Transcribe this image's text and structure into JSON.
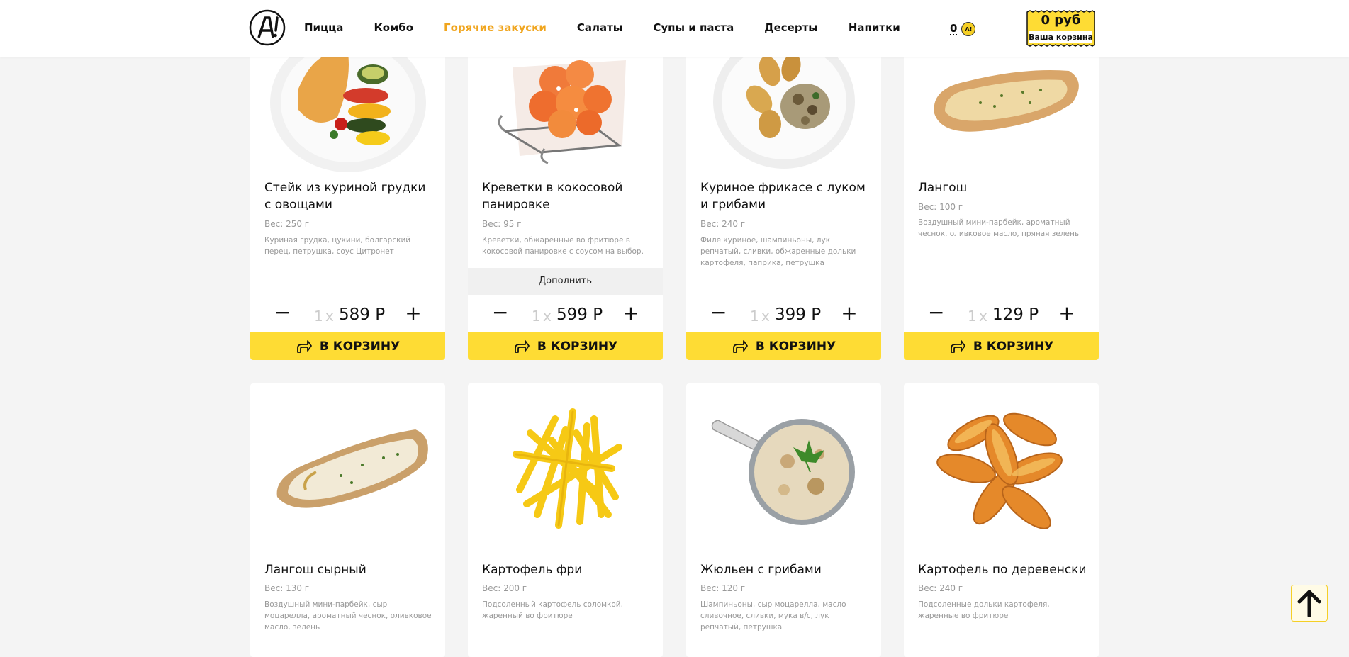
{
  "header": {
    "nav": [
      "Пицца",
      "Комбо",
      "Горячие закуски",
      "Салаты",
      "Супы и паста",
      "Десерты",
      "Напитки"
    ],
    "active_nav": "Горячие закуски",
    "coins": "0",
    "cart_sum": "0 руб",
    "cart_label": "Ваша корзина"
  },
  "products": [
    {
      "title": "Стейк из куриной грудки с овощами",
      "weight": "Вес: 250 г",
      "desc": "Куриная грудка, цукини, болгарский перец, петрушка, соус Цитронет",
      "count": "1",
      "price": "589 Р",
      "button": "В КОРЗИНУ"
    },
    {
      "title": "Креветки в кокосовой панировке",
      "weight": "Вес: 95 г",
      "desc": "Креветки, обжаренные во фритюре в кокосовой панировке с соусом на выбор.",
      "addon": "Дополнить",
      "count": "1",
      "price": "599 Р",
      "button": "В КОРЗИНУ"
    },
    {
      "title": "Куриное фрикасе с луком и грибами",
      "weight": "Вес: 240 г",
      "desc": "Филе куриное, шампиньоны, лук репчатый, сливки, обжаренные дольки картофеля, паприка, петрушка",
      "count": "1",
      "price": "399 Р",
      "button": "В КОРЗИНУ"
    },
    {
      "title": "Лангош",
      "weight": "Вес: 100 г",
      "desc": "Воздушный мини-парбейк, ароматный чеснок, оливковое масло, пряная зелень",
      "count": "1",
      "price": "129 Р",
      "button": "В КОРЗИНУ"
    },
    {
      "title": "Лангош сырный",
      "weight": "Вес: 130 г",
      "desc": "Воздушный мини-парбейк, сыр моцарелла, ароматный чеснок, оливковое масло, зелень"
    },
    {
      "title": "Картофель фри",
      "weight": "Вес: 200 г",
      "desc": "Подсоленный картофель соломкой, жаренный во фритюре"
    },
    {
      "title": "Жюльен с грибами",
      "weight": "Вес: 120 г",
      "desc": "Шампиньоны, сыр моцарелла, масло сливочное, сливки, мука в/с, лук репчатый, петрушка"
    },
    {
      "title": "Картофель по деревенски",
      "weight": "Вес: 240 г",
      "desc": "Подсоленные дольки картофеля, жаренные во фритюре"
    }
  ],
  "colors": {
    "accent": "#fedc34",
    "active_nav": "#f0a51e",
    "background": "#f4f4f4"
  }
}
